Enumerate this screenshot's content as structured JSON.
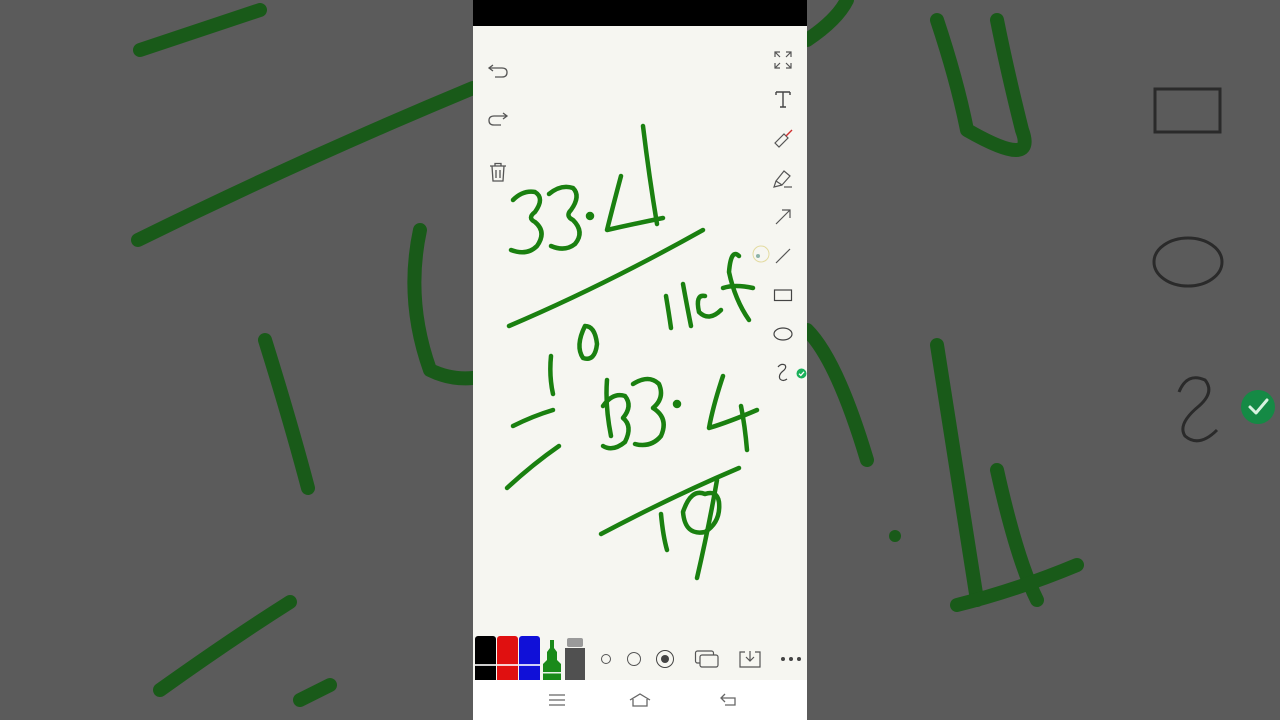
{
  "app": {
    "toolbar_left": [
      "undo-icon",
      "redo-icon",
      "trash-icon"
    ],
    "toolbar_right": [
      "fullscreen-icon",
      "text-tool-icon",
      "eraser-icon",
      "highlighter-icon",
      "arrow-tool-icon",
      "line-tool-icon",
      "rectangle-tool-icon",
      "ellipse-tool-icon",
      "freehand-tool-icon"
    ],
    "selected_tool": "freehand-tool-icon",
    "pen_colors": [
      "#000000",
      "#e01010",
      "#1010d8",
      "#1a8a1a",
      "#505050"
    ],
    "selected_color": "#1a8a1a",
    "stroke_color": "#1a8010",
    "selected_size_index": 2,
    "bottom_actions": [
      "pages-icon",
      "download-icon",
      "more-icon"
    ],
    "nav_buttons": [
      "recents-icon",
      "home-icon",
      "back-icon"
    ],
    "check_color": "#1bb05a"
  }
}
